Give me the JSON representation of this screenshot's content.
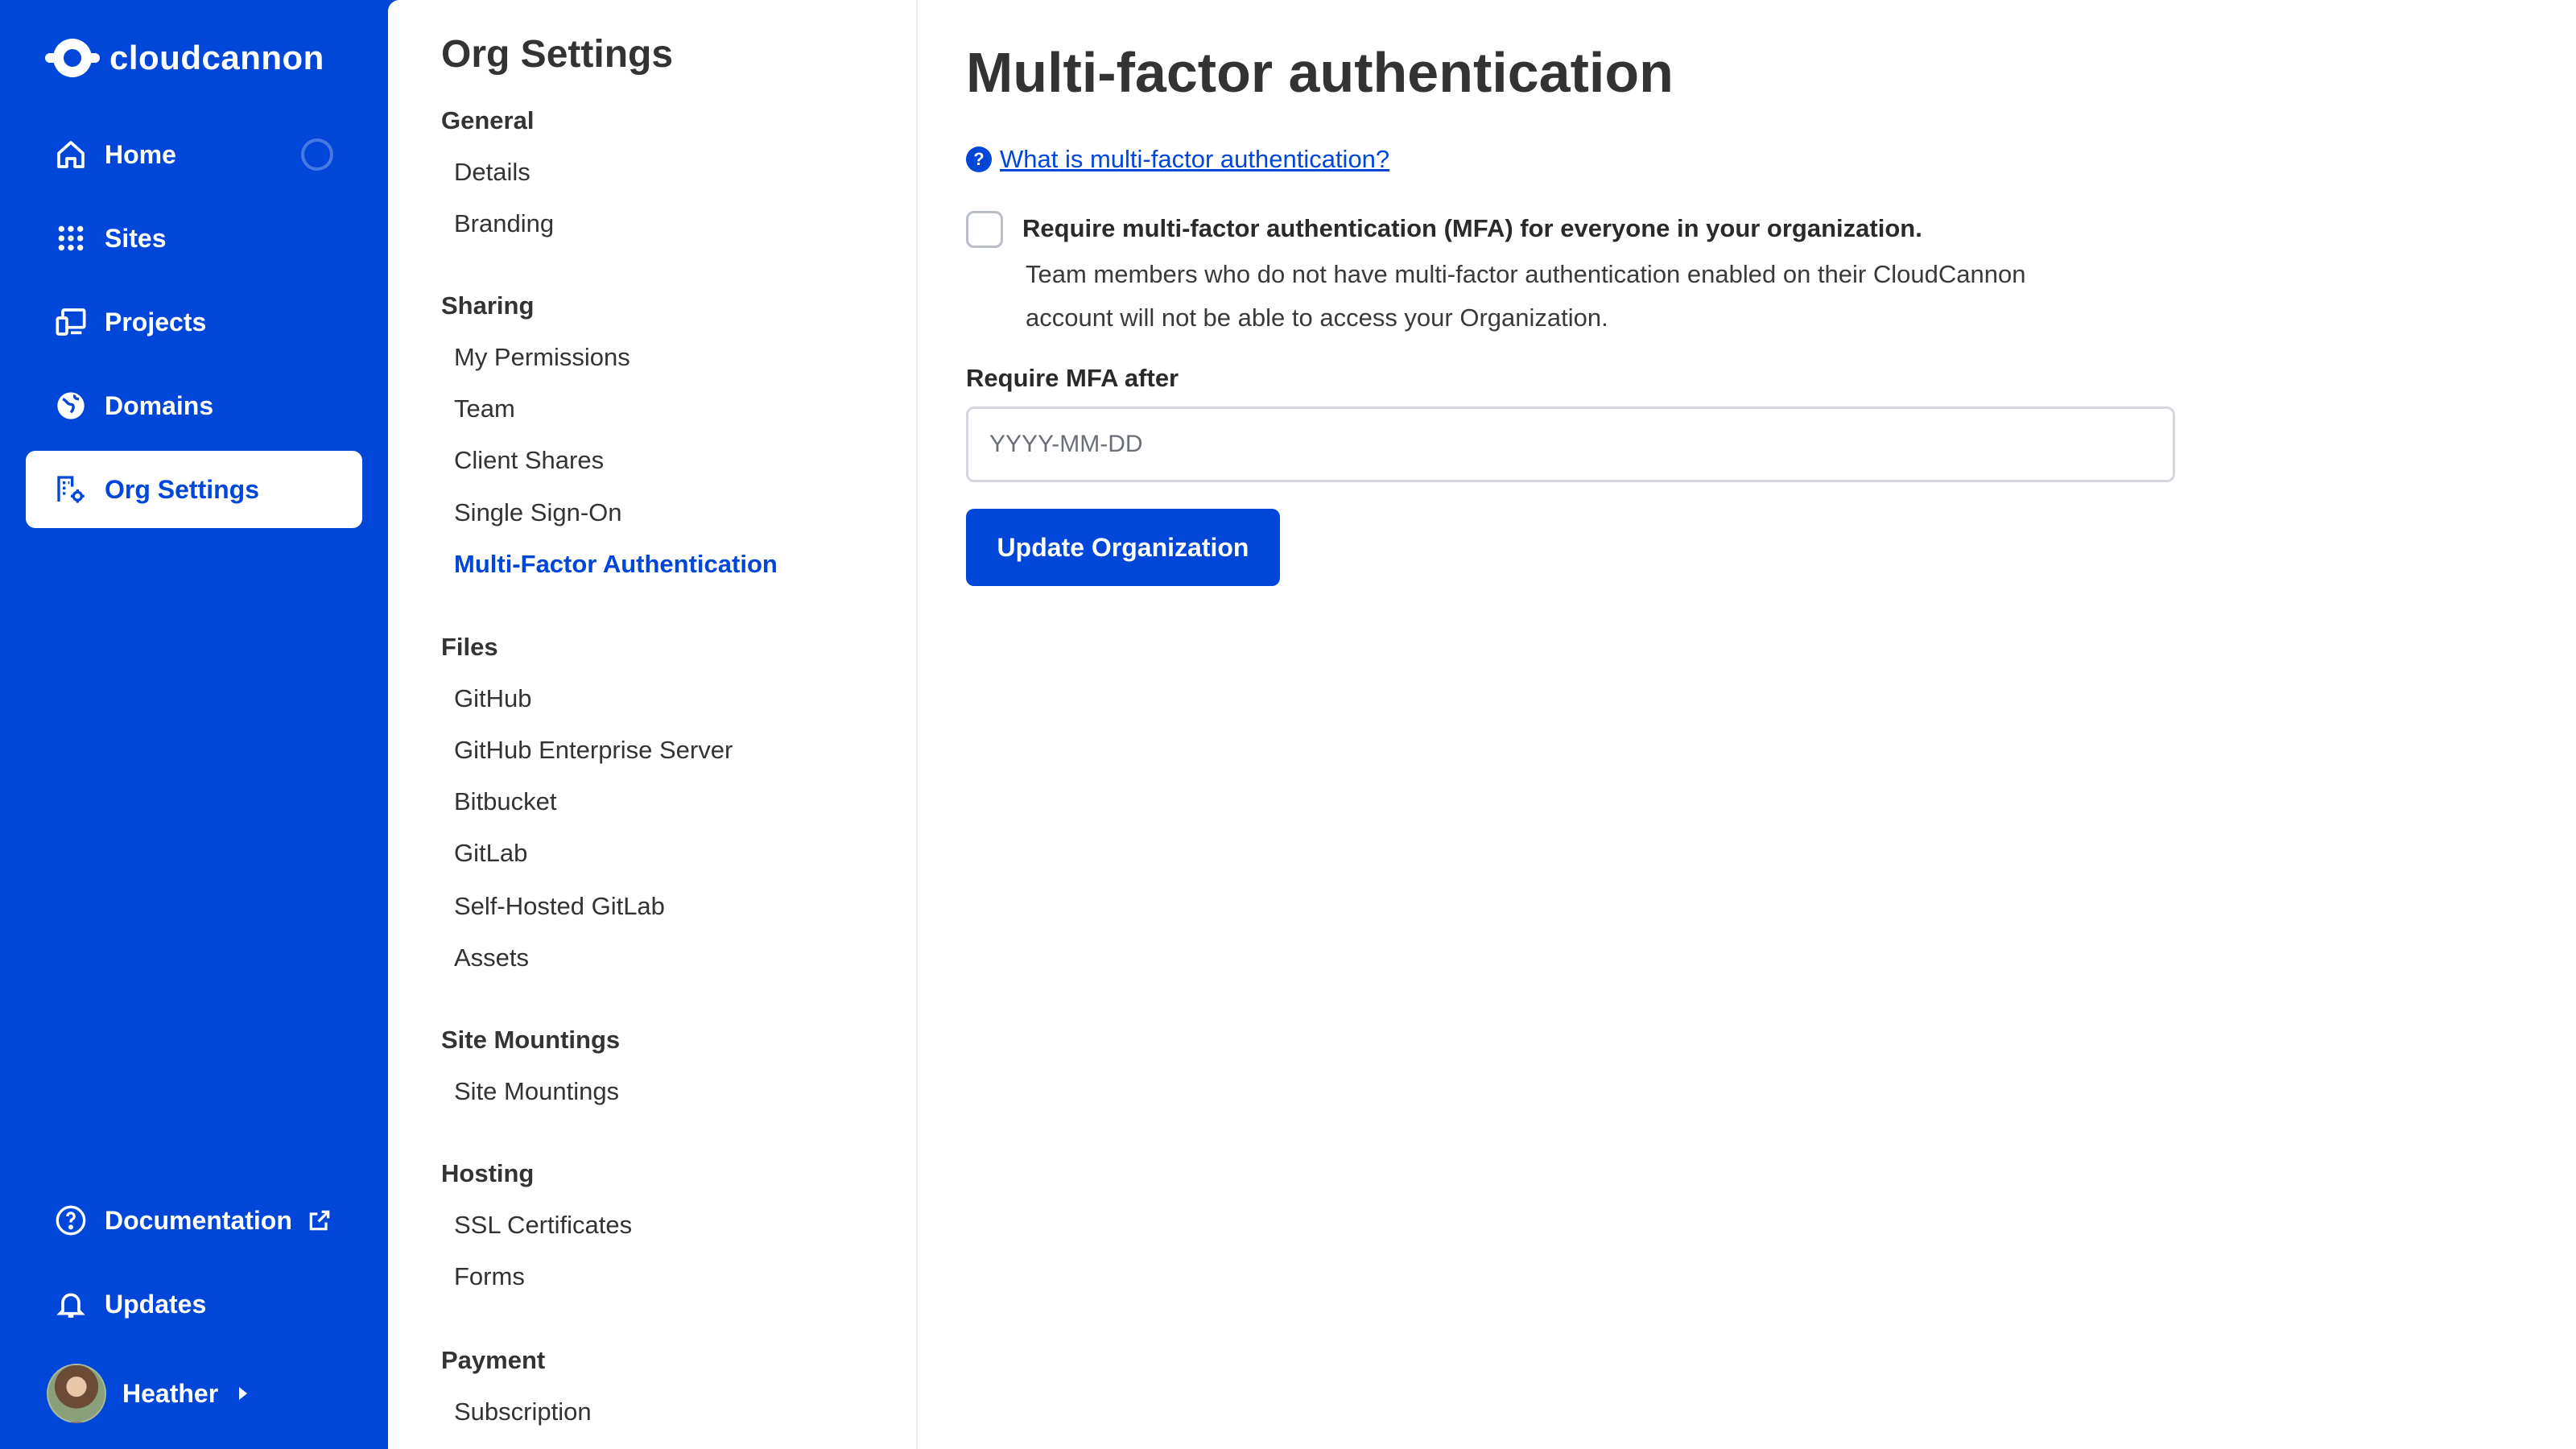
{
  "brand": {
    "name": "cloudcannon",
    "color": "#0046d9"
  },
  "nav": {
    "items": [
      {
        "label": "Home",
        "icon": "home-icon"
      },
      {
        "label": "Sites",
        "icon": "grid-icon"
      },
      {
        "label": "Projects",
        "icon": "devices-icon"
      },
      {
        "label": "Domains",
        "icon": "globe-icon"
      },
      {
        "label": "Org Settings",
        "icon": "building-gear-icon",
        "active": true
      }
    ],
    "bottom": [
      {
        "label": "Documentation",
        "icon": "question-circle-icon"
      },
      {
        "label": "Updates",
        "icon": "bell-icon"
      }
    ],
    "user": {
      "name": "Heather"
    }
  },
  "settings": {
    "title": "Org Settings",
    "sections": [
      {
        "heading": "General",
        "links": [
          "Details",
          "Branding"
        ]
      },
      {
        "heading": "Sharing",
        "links": [
          "My Permissions",
          "Team",
          "Client Shares",
          "Single Sign-On",
          "Multi-Factor Authentication"
        ]
      },
      {
        "heading": "Files",
        "links": [
          "GitHub",
          "GitHub Enterprise Server",
          "Bitbucket",
          "GitLab",
          "Self-Hosted GitLab",
          "Assets"
        ]
      },
      {
        "heading": "Site Mountings",
        "links": [
          "Site Mountings"
        ]
      },
      {
        "heading": "Hosting",
        "links": [
          "SSL Certificates",
          "Forms"
        ]
      },
      {
        "heading": "Payment",
        "links": [
          "Subscription"
        ]
      }
    ],
    "active_link": "Multi-Factor Authentication"
  },
  "main": {
    "title": "Multi-factor authentication",
    "help_link": "What is multi-factor authentication?",
    "checkbox": {
      "label": "Require multi-factor authentication (MFA) for everyone in your organization.",
      "description": "Team members who do not have multi-factor authentication enabled on their CloudCannon account will not be able to access your Organization.",
      "checked": false
    },
    "date_field": {
      "label": "Require MFA after",
      "placeholder": "YYYY-MM-DD",
      "value": ""
    },
    "submit_label": "Update Organization"
  }
}
